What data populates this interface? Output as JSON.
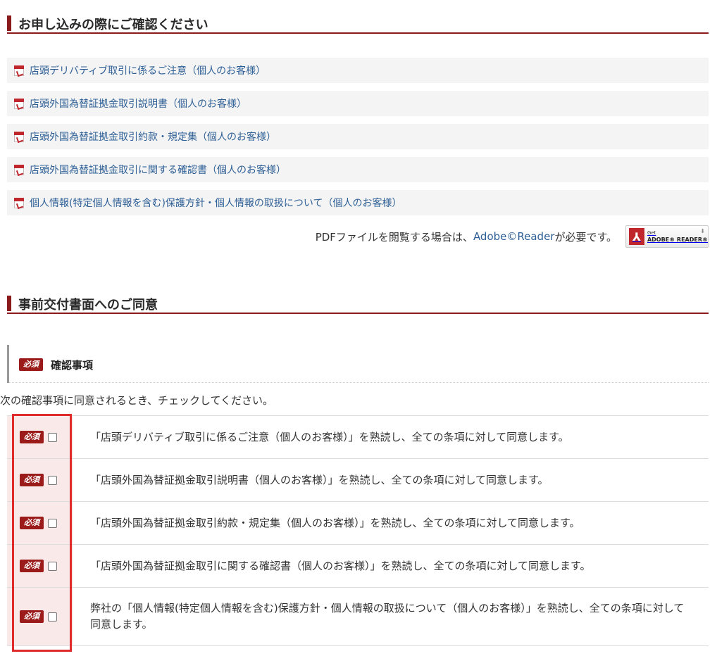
{
  "section1": {
    "title": "お申し込みの際にご確認ください"
  },
  "pdf_links": [
    {
      "label": "店頭デリバティブ取引に係るご注意（個人のお客様）"
    },
    {
      "label": "店頭外国為替証拠金取引説明書（個人のお客様）"
    },
    {
      "label": "店頭外国為替証拠金取引約款・規定集（個人のお客様）"
    },
    {
      "label": "店頭外国為替証拠金取引に関する確認書（個人のお客様）"
    },
    {
      "label": "個人情報(特定個人情報を含む)保護方針・個人情報の取扱について（個人のお客様）"
    }
  ],
  "adobe": {
    "prefix": "PDFファイルを閲覧する場合は、",
    "link": "Adobe©Reader",
    "suffix": "が必要です。",
    "badge_get": "Get",
    "badge_reader": "ADOBE® READER®"
  },
  "section2": {
    "title": "事前交付書面へのご同意"
  },
  "confirm": {
    "required_badge": "必須",
    "title": "確認事項",
    "instruction": "次の確認事項に同意されるとき、チェックしてください。",
    "items": [
      {
        "text": "「店頭デリバティブ取引に係るご注意（個人のお客様）」を熟読し、全ての条項に対して同意します。",
        "checked": false
      },
      {
        "text": "「店頭外国為替証拠金取引説明書（個人のお客様）」を熟読し、全ての条項に対して同意します。",
        "checked": false
      },
      {
        "text": "「店頭外国為替証拠金取引約款・規定集（個人のお客様）」を熟読し、全ての条項に対して同意します。",
        "checked": false
      },
      {
        "text": "「店頭外国為替証拠金取引に関する確認書（個人のお客様）」を熟読し、全ての条項に対して同意します。",
        "checked": false
      },
      {
        "text": "弊社の「個人情報(特定個人情報を含む)保護方針・個人情報の取扱について（個人のお客様）」を熟読し、全ての条項に対して同意します。",
        "checked": false
      }
    ]
  },
  "colors": {
    "accent": "#8b1a1a",
    "link": "#2d5f96",
    "badge": "#9b1b1b",
    "highlight": "#e02b2b"
  }
}
